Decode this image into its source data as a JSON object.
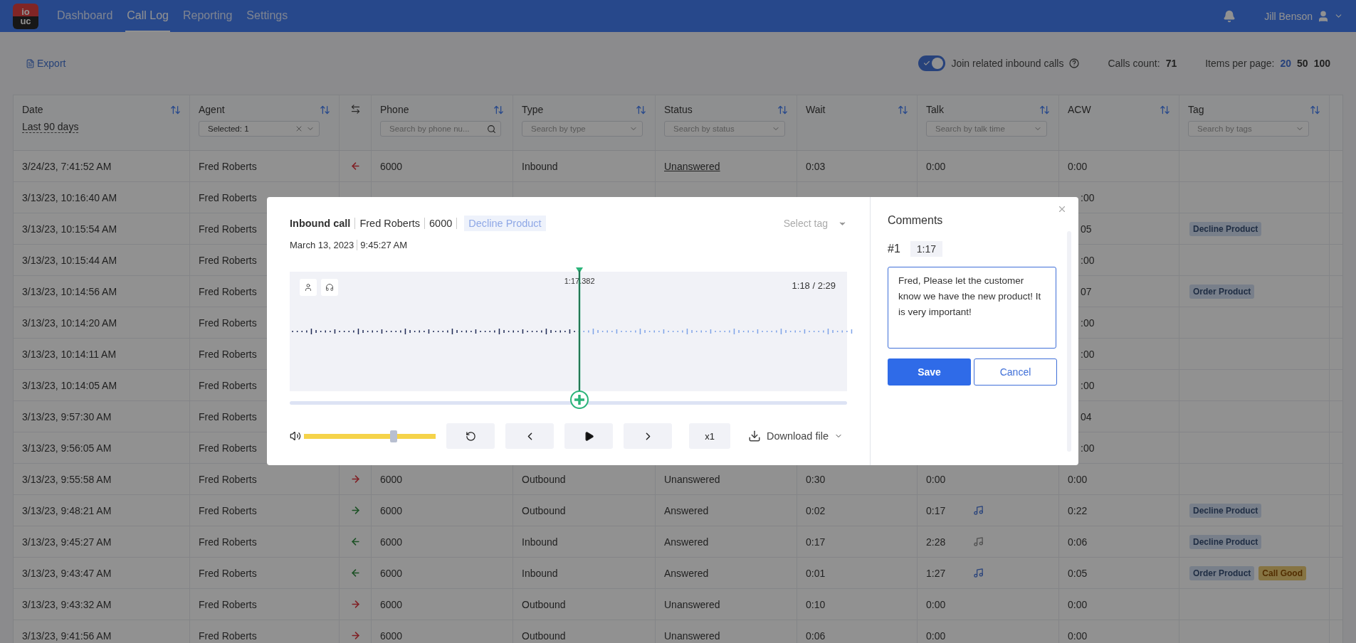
{
  "nav": {
    "logo_top": "io",
    "logo_bottom": "uc",
    "tabs": [
      {
        "label": "Dashboard",
        "selected": false
      },
      {
        "label": "Call Log",
        "selected": true
      },
      {
        "label": "Reporting",
        "selected": false
      },
      {
        "label": "Settings",
        "selected": false
      }
    ],
    "user": "Jill Benson"
  },
  "toolbar": {
    "export": "Export",
    "join_toggle": {
      "label": "Join related inbound calls",
      "on": true
    },
    "calls_count_label": "Calls count:",
    "calls_count": "71",
    "per_page_label": "Items per page:",
    "per_page": [
      {
        "label": "20",
        "selected": true
      },
      {
        "label": "50",
        "selected": false
      },
      {
        "label": "100",
        "selected": false
      }
    ]
  },
  "columns": [
    {
      "kind": "date",
      "label": "Date",
      "link": "Last 90 days"
    },
    {
      "kind": "agent",
      "label": "Agent",
      "value": "Selected: 1"
    },
    {
      "kind": "direction"
    },
    {
      "kind": "search",
      "label": "Phone",
      "placeholder": "Search by phone nu..."
    },
    {
      "kind": "select",
      "label": "Type",
      "placeholder": "Search by type"
    },
    {
      "kind": "select",
      "label": "Status",
      "placeholder": "Search by status"
    },
    {
      "kind": "plain",
      "label": "Wait"
    },
    {
      "kind": "select",
      "label": "Talk",
      "placeholder": "Search by talk time"
    },
    {
      "kind": "plain",
      "label": "ACW"
    },
    {
      "kind": "select",
      "label": "Tag",
      "placeholder": "Search by tags"
    }
  ],
  "rows": [
    {
      "date": "3/24/23, 7:41:52 AM",
      "agent": "Fred Roberts",
      "kind": "in",
      "answered": false,
      "phone": "6000",
      "type": "Inbound",
      "status": "Unanswered",
      "linked": true,
      "wait": "0:03",
      "talk": "0:00",
      "acw": "0:00"
    },
    {
      "date": "3/13/23, 10:16:40 AM",
      "agent": "Fred Roberts",
      "acw": ":00"
    },
    {
      "date": "3/13/23, 10:15:54 AM",
      "agent": "Fred Roberts",
      "acw": "05",
      "tags": [
        {
          "label": "Decline Product",
          "color": "#787f8a"
        }
      ]
    },
    {
      "date": "3/13/23, 10:15:44 AM",
      "agent": "Fred Roberts",
      "acw": ":00"
    },
    {
      "date": "3/13/23, 10:14:56 AM",
      "agent": "Fred Roberts",
      "acw": "07",
      "tags": [
        {
          "label": "Order Product",
          "color": "#787f8a"
        }
      ]
    },
    {
      "date": "3/13/23, 10:14:20 AM",
      "agent": "Fred Roberts",
      "acw": ":00"
    },
    {
      "date": "3/13/23, 10:14:11 AM",
      "agent": "Fred Roberts",
      "acw": ":00"
    },
    {
      "date": "3/13/23, 10:14:05 AM",
      "agent": "Fred Roberts",
      "acw": ":00"
    },
    {
      "date": "3/13/23, 9:57:30 AM",
      "agent": "Fred Roberts",
      "acw": "04"
    },
    {
      "date": "3/13/23, 9:56:05 AM",
      "agent": "Fred Roberts",
      "acw": ":00"
    },
    {
      "date": "3/13/23, 9:55:58 AM",
      "agent": "Fred Roberts",
      "kind": "out",
      "answered": false,
      "phone": "6000",
      "type": "Outbound",
      "status": "Unanswered",
      "linked": false,
      "wait": "0:30",
      "talk": "0:00",
      "acw": "0:00"
    },
    {
      "date": "3/13/23, 9:48:21 AM",
      "agent": "Fred Roberts",
      "kind": "out",
      "answered": true,
      "phone": "6000",
      "type": "Outbound",
      "status": "Answered",
      "linked": false,
      "wait": "0:02",
      "talk": "0:17",
      "recording": {
        "listened": false
      },
      "acw": "0:22",
      "tags": [
        {
          "label": "Decline Product",
          "color": "#787f8a"
        }
      ]
    },
    {
      "date": "3/13/23, 9:45:27 AM",
      "agent": "Fred Roberts",
      "kind": "in",
      "answered": true,
      "phone": "6000",
      "type": "Inbound",
      "status": "Answered",
      "linked": false,
      "wait": "0:17",
      "talk": "2:28",
      "recording": {
        "listened": true
      },
      "acw": "0:06",
      "tags": [
        {
          "label": "Decline Product",
          "color": "#787f8a"
        }
      ]
    },
    {
      "date": "3/13/23, 9:43:47 AM",
      "agent": "Fred Roberts",
      "kind": "in",
      "answered": true,
      "phone": "6000",
      "type": "Inbound",
      "status": "Answered",
      "linked": false,
      "wait": "0:01",
      "talk": "1:27",
      "recording": {
        "listened": false
      },
      "acw": "0:05",
      "tags": [
        {
          "label": "Order Product",
          "color": "#787f8a"
        },
        {
          "label": "Call Good",
          "color": "#867443"
        }
      ]
    },
    {
      "date": "3/13/23, 9:43:32 AM",
      "agent": "Fred Roberts",
      "kind": "out",
      "answered": false,
      "phone": "6000",
      "type": "Outbound",
      "status": "Unanswered",
      "linked": false,
      "wait": "0:10",
      "talk": "0:00",
      "acw": "0:00"
    },
    {
      "date": "3/13/23, 9:41:56 AM",
      "agent": "Fred Roberts",
      "kind": "out",
      "answered": false,
      "phone": "6000",
      "type": "Outbound",
      "status": "Unanswered",
      "linked": false,
      "wait": "0:06",
      "talk": "0:00",
      "acw": "0:00"
    }
  ],
  "modal": {
    "call_type": "Inbound call",
    "agent": "Fred Roberts",
    "phone": "6000",
    "tag": "Decline Product",
    "date": "March 13, 2023",
    "time": "9:45:27 AM",
    "select_tag": "Select tag",
    "playhead": {
      "level": 0.52,
      "label": "1:17.382"
    },
    "position": "1:18 / 2:29",
    "volume": {
      "level": 0.68
    },
    "speed": "x1",
    "download": "Download file",
    "comments": {
      "title": "Comments",
      "number": "#1",
      "timestamp": "1:17",
      "text": "Fred, Please let the customer know we have the new product! It is very important!",
      "save": "Save",
      "cancel": "Cancel"
    }
  }
}
